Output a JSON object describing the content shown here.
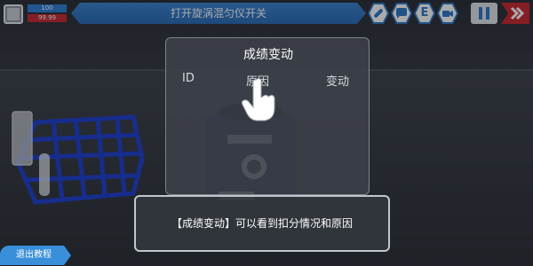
{
  "hud": {
    "score": "100",
    "health": "99.99",
    "task": "打开旋涡混匀仪开关",
    "e_label": "E"
  },
  "icons": {
    "bandage": "bandage-icon",
    "chat": "chat-bubble-icon",
    "camera": "video-camera-icon",
    "pause": "pause-icon",
    "next": "double-chevron-right-icon",
    "hand": "pointing-hand-icon"
  },
  "panel": {
    "title": "成绩变动",
    "columns": [
      "ID",
      "原因",
      "变动"
    ]
  },
  "tip": {
    "text": "【成绩变动】可以看到扣分情况和原因"
  },
  "exit": {
    "label": "退出教程"
  },
  "colors": {
    "accent_blue": "#2f7fd6",
    "health_red": "#c8282e",
    "panel_bg": "#3e424a"
  }
}
